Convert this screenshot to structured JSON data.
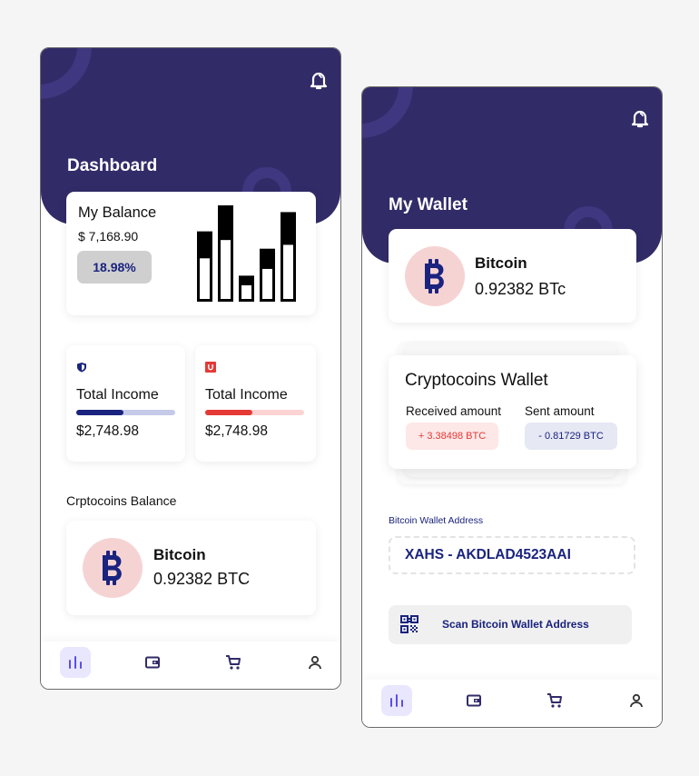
{
  "colors": {
    "header": "#312b68",
    "accent_blue": "#1a237e",
    "accent_red": "#e53935",
    "nav_active": "#e9e7fd"
  },
  "dashboard": {
    "title": "Dashboard",
    "balance": {
      "label": "My Balance",
      "amount": "$ 7,168.90",
      "change": "18.98%",
      "bars": [
        {
          "total": 0.73,
          "light": 0.45
        },
        {
          "total": 1.0,
          "light": 0.64
        },
        {
          "total": 0.27,
          "light": 0.17
        },
        {
          "total": 0.55,
          "light": 0.34
        },
        {
          "total": 0.93,
          "light": 0.59
        }
      ]
    },
    "income_cards": [
      {
        "icon": "shield-icon",
        "title": "Total Income",
        "value": "$2,748.98",
        "progress": 0.48,
        "color": "#1a237e",
        "track": "#c5cae9"
      },
      {
        "icon": "magnet-icon",
        "title": "Total Income",
        "value": "$2,748.98",
        "progress": 0.48,
        "color": "#e53935",
        "track": "#fbd3d3"
      }
    ],
    "section_label": "Crptocoins Balance",
    "coin": {
      "name": "Bitcoin",
      "amount": "0.92382 BTC"
    }
  },
  "wallet": {
    "title": "My Wallet",
    "coin": {
      "name": "Bitcoin",
      "amount": "0.92382 BTc"
    },
    "crypto_wallet": {
      "title": "Cryptocoins Wallet",
      "received_label": "Received amount",
      "received_value": "+ 3.38498 BTC",
      "sent_label": "Sent amount",
      "sent_value": "- 0.81729 BTC"
    },
    "address_label": "Bitcoin Wallet Address",
    "address_value": "XAHS - AKDLAD4523AAI",
    "scan_label": "Scan Bitcoin Wallet Address"
  },
  "nav": {
    "items": [
      {
        "name": "stats",
        "active": true
      },
      {
        "name": "wallet",
        "active": false
      },
      {
        "name": "cart",
        "active": false
      },
      {
        "name": "profile",
        "active": false
      }
    ]
  }
}
